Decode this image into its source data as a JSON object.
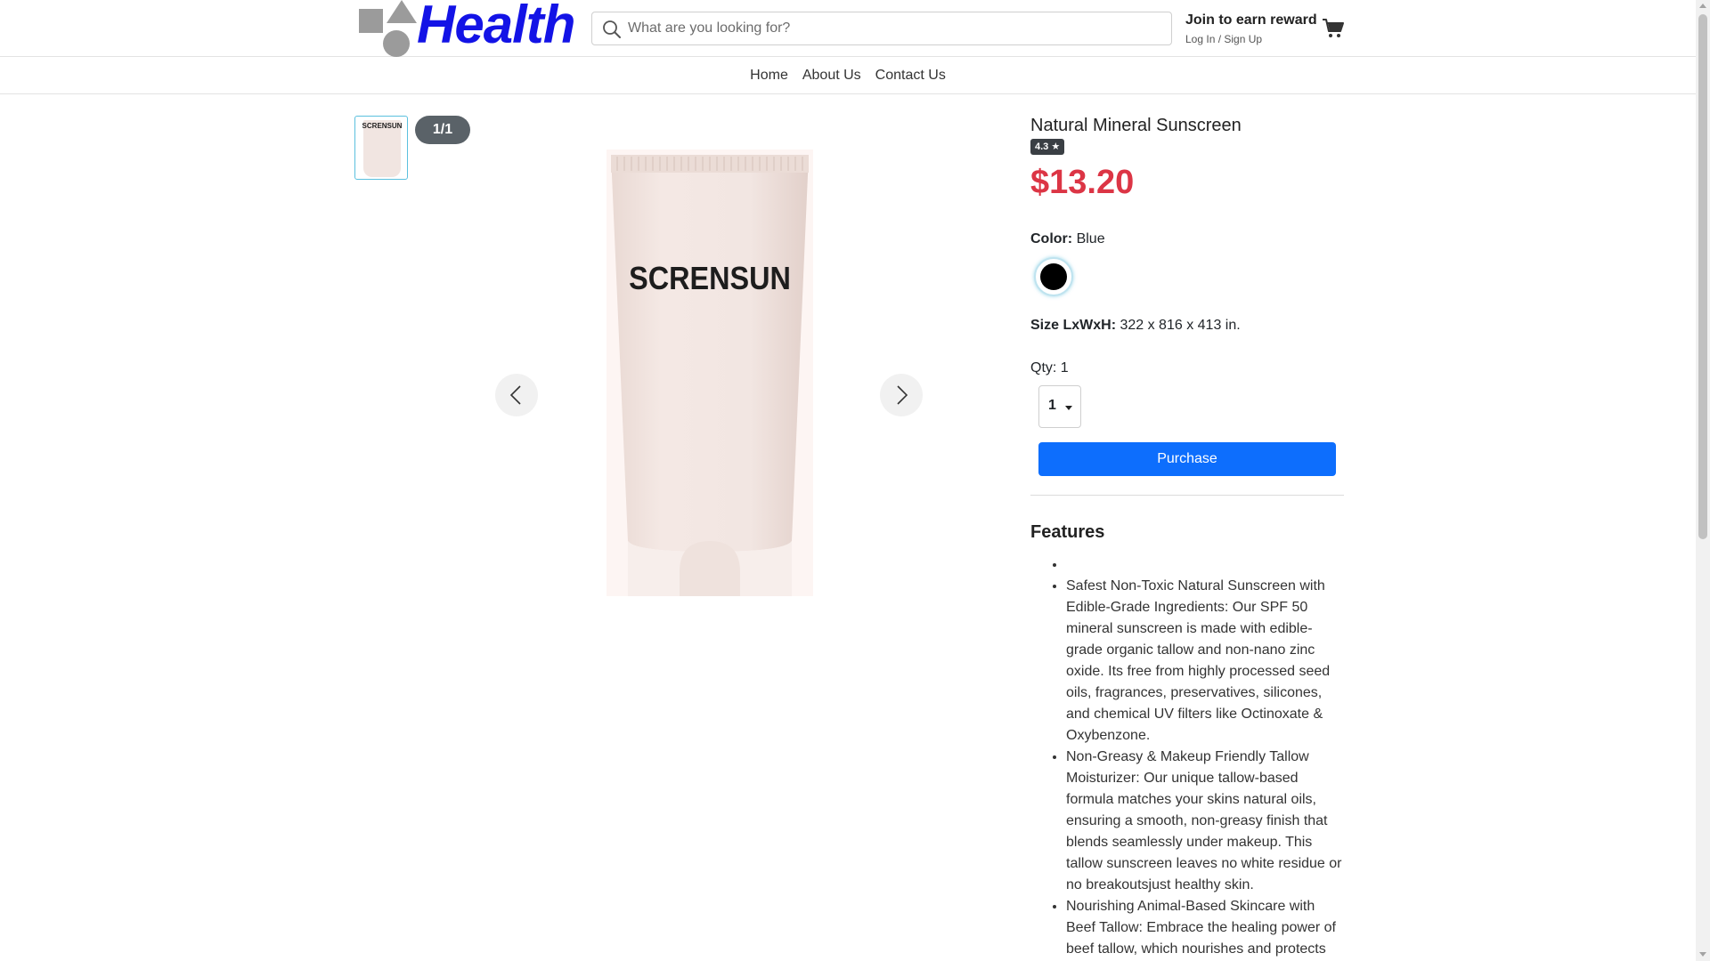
{
  "brand": {
    "name": "Health",
    "logo_color": "#1313e6"
  },
  "search": {
    "placeholder": "What are you looking for?",
    "value": ""
  },
  "account": {
    "reward_title": "Join to earn reward",
    "login_text": "Log In / Sign Up"
  },
  "icons": {
    "search": "search-icon",
    "cart": "cart-icon",
    "prev": "chevron-left-icon",
    "next": "chevron-right-icon"
  },
  "nav": {
    "items": [
      {
        "label": "Home"
      },
      {
        "label": "About Us"
      },
      {
        "label": "Contact Us"
      }
    ]
  },
  "gallery": {
    "counter": "1/1",
    "thumb_label": "SCRENSUN",
    "image_label": "SCRENSUN"
  },
  "product": {
    "title": "Natural Mineral Sunscreen",
    "rating": "4.3 ★",
    "price": "$13.20",
    "price_color": "#dc3545",
    "color_label": "Color:",
    "color_value": "Blue",
    "swatch_color": "#000000",
    "size_label": "Size LxWxH:",
    "size_value": "322 x 816 x 413 in.",
    "qty_label": "Qty:",
    "qty_value": "1",
    "qty_selected": "1",
    "purchase_label": "Purchase",
    "purchase_color": "#0d6efd"
  },
  "features": {
    "title": "Features",
    "items": [
      "",
      "Safest Non-Toxic Natural Sunscreen with Edible-Grade Ingredients: Our SPF 50 mineral sunscreen is made with edible-grade organic tallow and non-nano zinc oxide. Its free from highly processed seed oils, fragrances, preservatives, silicones, and chemical UV filters like Octinoxate & Oxybenzone.",
      "Non-Greasy & Makeup Friendly Tallow Moisturizer: Our unique tallow-based formula matches your skins natural oils, ensuring a smooth, non-greasy finish that blends seamlessly under makeup. This tallow sunscreen leaves no white residue or no breakoutsjust healthy skin.",
      "Nourishing Animal-Based Skincare with Beef Tallow: Embrace the healing power of beef tallow, which nourishes and protects"
    ]
  }
}
